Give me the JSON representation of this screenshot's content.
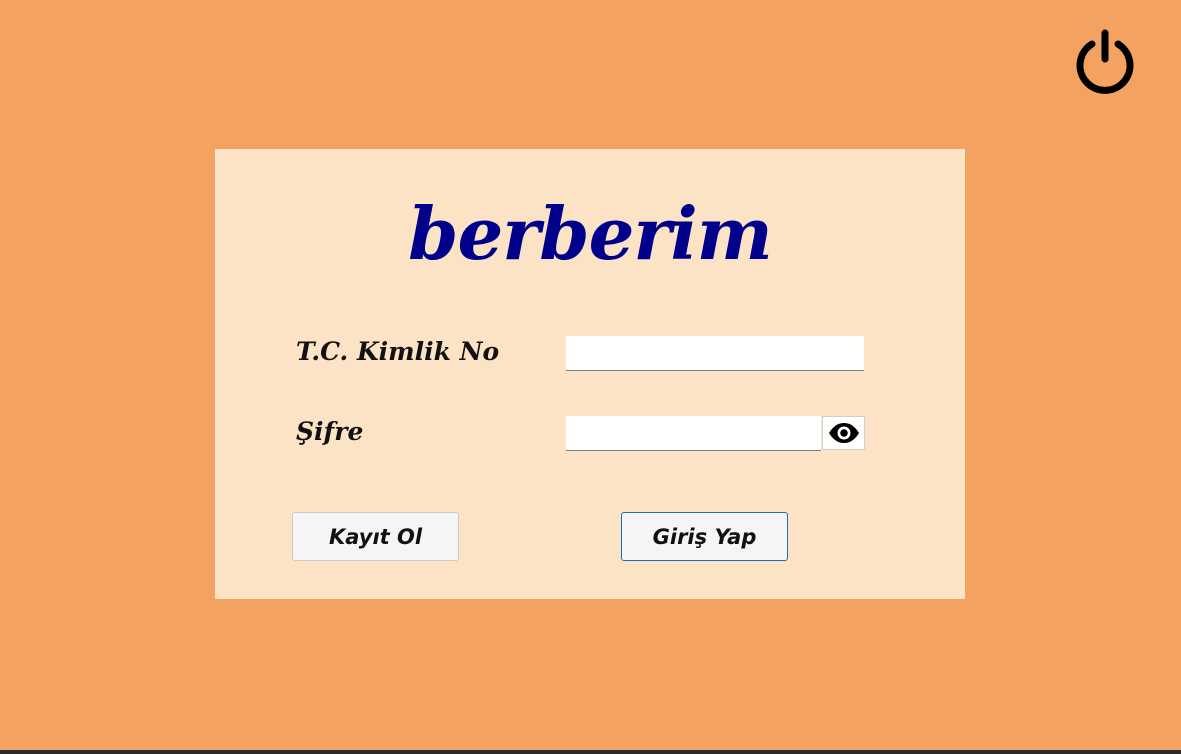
{
  "app": {
    "brand": "berberim"
  },
  "login_form": {
    "tc_label": "T.C. Kimlik No",
    "tc_value": "",
    "password_label": "Şifre",
    "password_value": ""
  },
  "buttons": {
    "register_label": "Kayıt Ol",
    "login_label": "Giriş Yap"
  },
  "icons": {
    "power": "power-icon",
    "show_password": "eye-icon"
  },
  "colors": {
    "background": "#F4A261",
    "panel": "#FDE3C5",
    "brand": "#00008B",
    "login_border": "#1A70B8"
  }
}
